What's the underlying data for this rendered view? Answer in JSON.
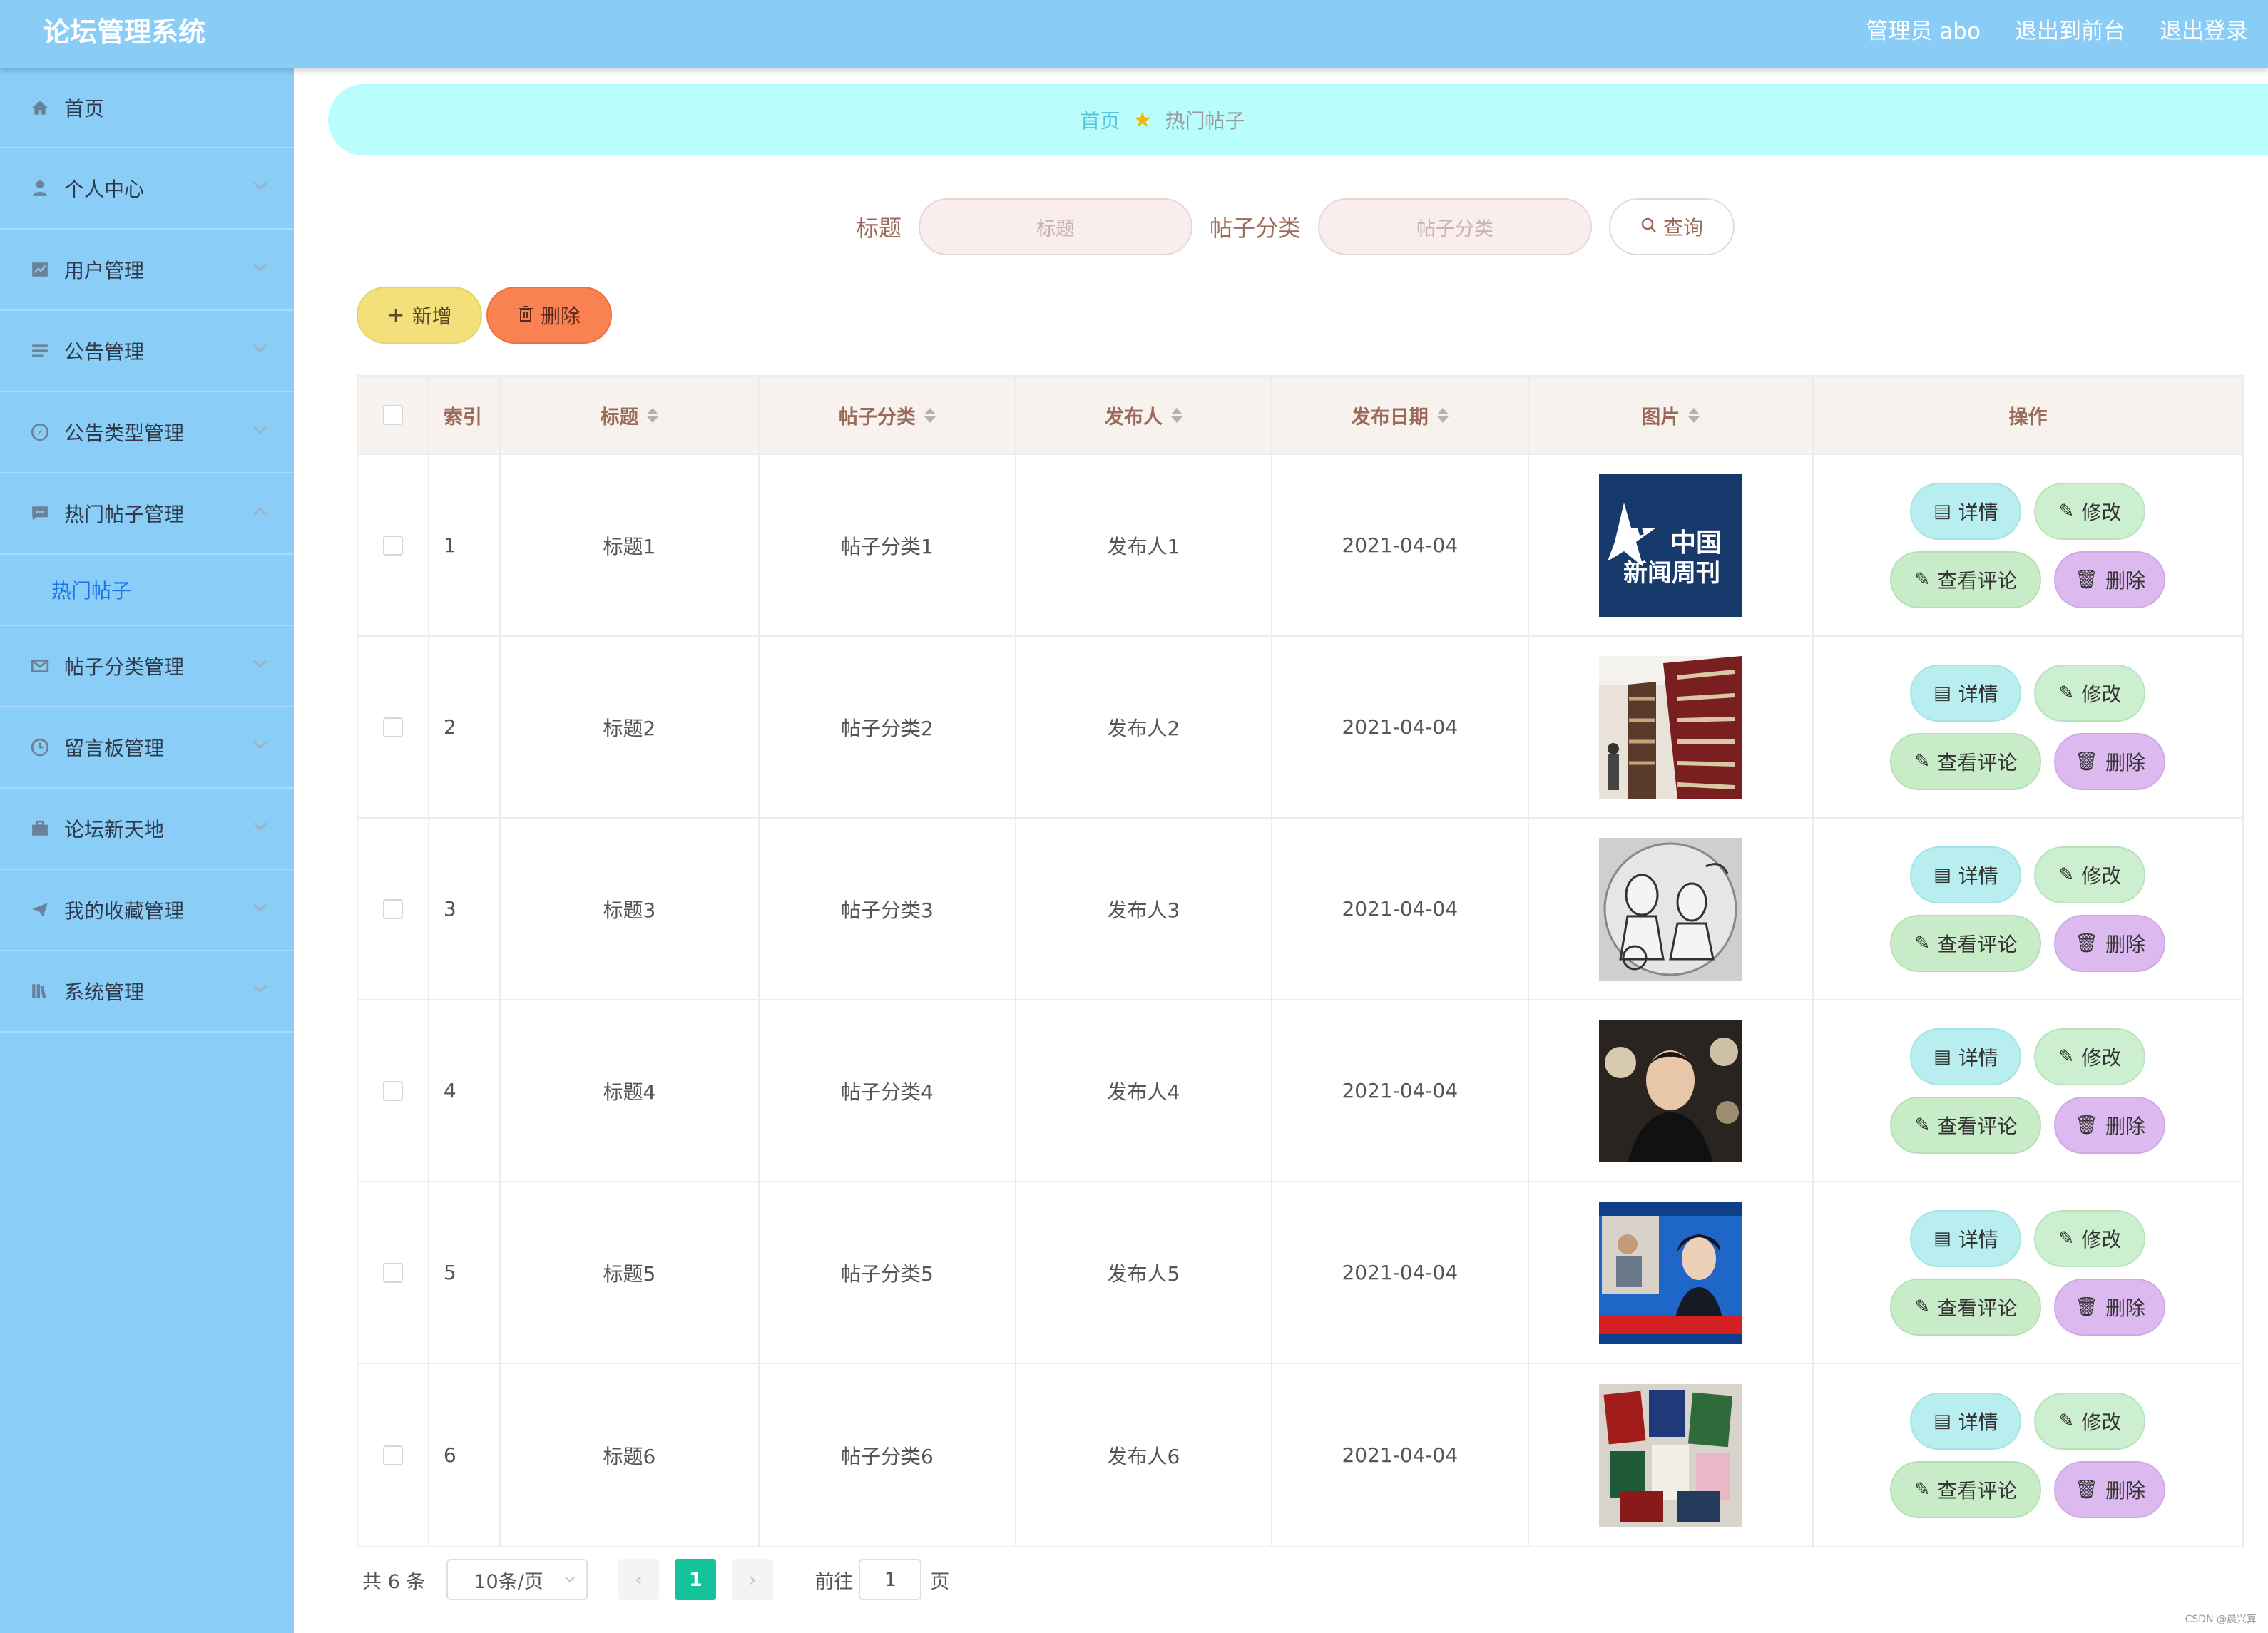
{
  "header": {
    "title": "论坛管理系统",
    "admin": "管理员 abo",
    "to_front": "退出到前台",
    "logout": "退出登录"
  },
  "sidebar": {
    "items": [
      {
        "label": "首页",
        "icon": "home-icon"
      },
      {
        "label": "个人中心",
        "icon": "user-icon"
      },
      {
        "label": "用户管理",
        "icon": "chart-icon"
      },
      {
        "label": "公告管理",
        "icon": "list-icon"
      },
      {
        "label": "公告类型管理",
        "icon": "compass-icon"
      },
      {
        "label": "热门帖子管理",
        "icon": "chat-icon"
      },
      {
        "label": "帖子分类管理",
        "icon": "mail-icon"
      },
      {
        "label": "留言板管理",
        "icon": "clock-icon"
      },
      {
        "label": "论坛新天地",
        "icon": "briefcase-icon"
      },
      {
        "label": "我的收藏管理",
        "icon": "send-icon"
      },
      {
        "label": "系统管理",
        "icon": "library-icon"
      }
    ],
    "submenu_active": "热门帖子"
  },
  "breadcrumb": {
    "home": "首页",
    "current": "热门帖子"
  },
  "search": {
    "title_label": "标题",
    "title_placeholder": "标题",
    "category_label": "帖子分类",
    "category_placeholder": "帖子分类",
    "query_button": "查询"
  },
  "actions": {
    "add": "新增",
    "delete": "删除"
  },
  "table": {
    "columns": {
      "index": "索引",
      "title": "标题",
      "category": "帖子分类",
      "publisher": "发布人",
      "date": "发布日期",
      "image": "图片",
      "ops": "操作"
    },
    "ops_labels": {
      "detail": "详情",
      "edit": "修改",
      "comment": "查看评论",
      "delete": "删除"
    },
    "rows": [
      {
        "index": "1",
        "title": "标题1",
        "category": "帖子分类1",
        "publisher": "发布人1",
        "date": "2021-04-04",
        "thumb_text_1": "中国",
        "thumb_text_2": "新闻周刊"
      },
      {
        "index": "2",
        "title": "标题2",
        "category": "帖子分类2",
        "publisher": "发布人2",
        "date": "2021-04-04"
      },
      {
        "index": "3",
        "title": "标题3",
        "category": "帖子分类3",
        "publisher": "发布人3",
        "date": "2021-04-04"
      },
      {
        "index": "4",
        "title": "标题4",
        "category": "帖子分类4",
        "publisher": "发布人4",
        "date": "2021-04-04"
      },
      {
        "index": "5",
        "title": "标题5",
        "category": "帖子分类5",
        "publisher": "发布人5",
        "date": "2021-04-04"
      },
      {
        "index": "6",
        "title": "标题6",
        "category": "帖子分类6",
        "publisher": "发布人6",
        "date": "2021-04-04"
      }
    ]
  },
  "pagination": {
    "total": "共 6 条",
    "page_size": "10条/页",
    "current": "1",
    "goto_label": "前往",
    "goto_value": "1",
    "page_suffix": "页"
  },
  "watermark": "CSDN @晨兴算"
}
